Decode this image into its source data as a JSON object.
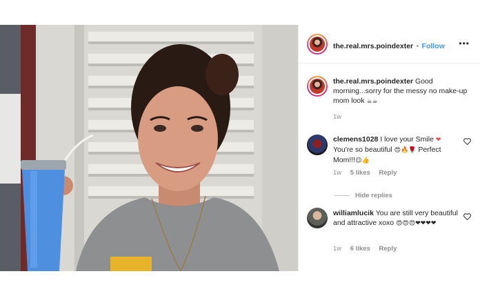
{
  "post": {
    "author": "the.real.mrs.poindexter",
    "separator": "•",
    "follow_label": "Follow",
    "more_label": "•••",
    "caption_text": "Good morning...sorry for the messy no make-up mom look",
    "caption_emoji": "☕☕",
    "caption_time": "1w"
  },
  "comments": [
    {
      "username": "clemens1028",
      "text": "I love your Smile",
      "emoji_1": "❤",
      "text_2": "You're so beautiful",
      "emoji_2": "😍🔥🌹",
      "text_3": "Perfect Mom!!!",
      "emoji_3": "😉👍",
      "time": "1w",
      "likes": "5 likes",
      "reply_label": "Reply"
    },
    {
      "username": "williamlucik",
      "text": "You are still very beautiful and attractive xoxo",
      "emoji_1": "😍😍😍❤❤❤❤",
      "time": "1w",
      "likes": "6 likes",
      "reply_label": "Reply"
    }
  ],
  "hide_replies_label": "Hide replies",
  "colors": {
    "link_blue": "#3897f0",
    "muted_gray": "#8e8e8e",
    "text_dark": "#262626",
    "heart_red": "#ed4956"
  },
  "icons": [
    "heart-outline-icon",
    "more-options-icon"
  ]
}
